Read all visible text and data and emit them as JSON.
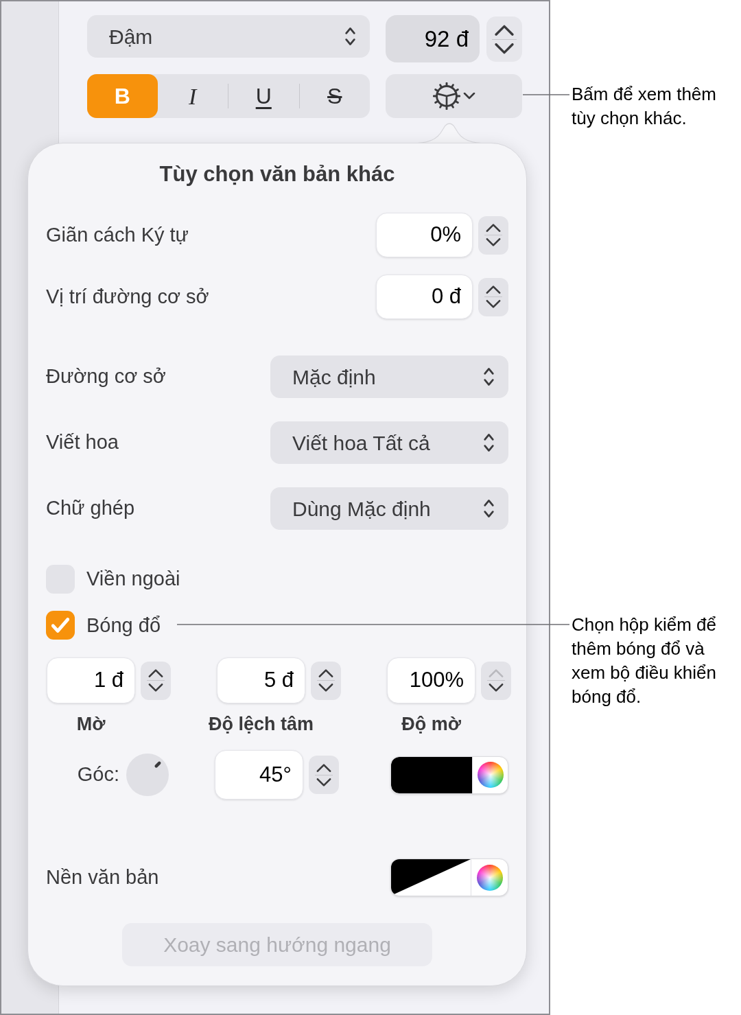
{
  "toolbar": {
    "font_style": {
      "value": "Đậm"
    },
    "font_size": {
      "value": "92 đ"
    },
    "style_buttons": [
      {
        "kind": "bold",
        "label": "B",
        "selected": true
      },
      {
        "kind": "italic",
        "label": "I",
        "selected": false
      },
      {
        "kind": "underline",
        "label": "U",
        "selected": false
      },
      {
        "kind": "strikethrough",
        "label": "S",
        "selected": false
      }
    ]
  },
  "popover": {
    "title": "Tùy chọn văn bản khác",
    "rows": [
      {
        "kind": "number",
        "label": "Giãn cách Ký tự",
        "value": "0%"
      },
      {
        "kind": "number",
        "label": "Vị trí đường cơ sở",
        "value": "0 đ"
      },
      {
        "kind": "select",
        "label": "Đường cơ sở",
        "value": "Mặc định"
      },
      {
        "kind": "select",
        "label": "Viết hoa",
        "value": "Viết hoa Tất cả"
      },
      {
        "kind": "select",
        "label": "Chữ ghép",
        "value": "Dùng Mặc định"
      }
    ],
    "checkboxes": [
      {
        "label": "Viền ngoài",
        "checked": false
      },
      {
        "label": "Bóng đổ",
        "checked": true
      }
    ],
    "shadow": {
      "fields": [
        {
          "value": "1 đ",
          "label": "Mờ",
          "increment_disabled": false
        },
        {
          "value": "5 đ",
          "label": "Độ lệch tâm",
          "increment_disabled": false
        },
        {
          "value": "100%",
          "label": "Độ mờ",
          "increment_disabled": true
        }
      ],
      "angle": {
        "label": "Góc:",
        "value": "45°"
      }
    },
    "text_background": {
      "label": "Nền văn bản"
    },
    "rotate_button": {
      "label": "Xoay sang hướng ngang",
      "disabled": true
    }
  },
  "callouts": [
    {
      "text": "Bấm để xem thêm tùy chọn khác."
    },
    {
      "text": "Chọn hộp kiểm để thêm bóng đổ và xem bộ điều khiển bóng đổ."
    }
  ]
}
